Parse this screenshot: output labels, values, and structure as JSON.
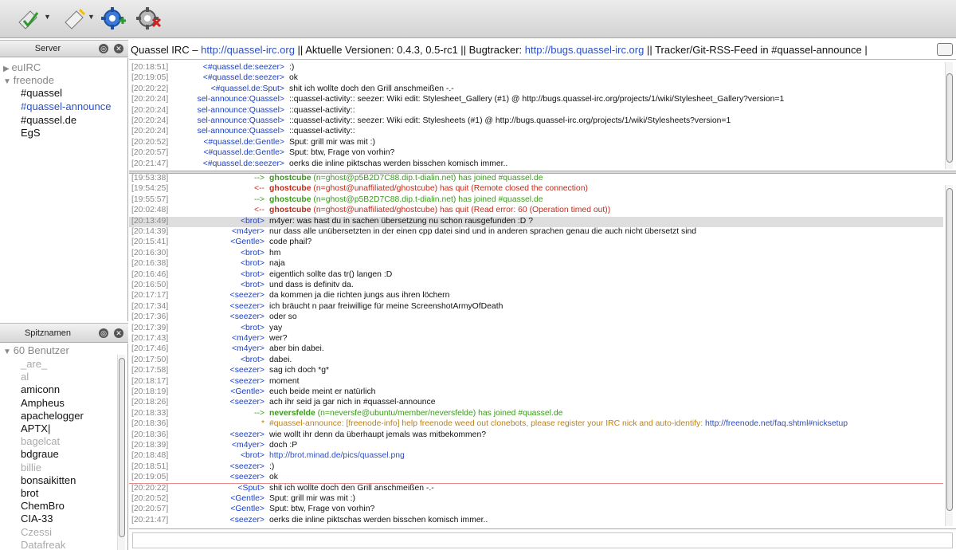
{
  "toolbar": {
    "buttons": [
      {
        "name": "connect-icon"
      },
      {
        "name": "disconnect-icon"
      },
      {
        "name": "add-network-icon"
      },
      {
        "name": "remove-network-icon"
      }
    ]
  },
  "server_panel": {
    "title": "Server",
    "networks": [
      {
        "label": "euIRC",
        "expanded": false
      },
      {
        "label": "freenode",
        "expanded": true,
        "channels": [
          "#quassel",
          "#quassel-announce",
          "#quassel.de",
          "EgS"
        ]
      }
    ]
  },
  "nick_panel": {
    "title": "Spitznamen",
    "count_label": "60 Benutzer",
    "nicks": [
      {
        "n": "_are_",
        "away": true
      },
      {
        "n": "al",
        "away": true
      },
      {
        "n": "amiconn",
        "away": false
      },
      {
        "n": "Ampheus",
        "away": false
      },
      {
        "n": "apachelogger",
        "away": false
      },
      {
        "n": "APTX|",
        "away": false
      },
      {
        "n": "bagelcat",
        "away": true
      },
      {
        "n": "bdgraue",
        "away": false
      },
      {
        "n": "billie",
        "away": true
      },
      {
        "n": "bonsaikitten",
        "away": false
      },
      {
        "n": "brot",
        "away": false
      },
      {
        "n": "ChemBro",
        "away": false
      },
      {
        "n": "CIA-33",
        "away": false
      },
      {
        "n": "Czessi",
        "away": true
      },
      {
        "n": "Datafreak",
        "away": true
      }
    ]
  },
  "topic": {
    "parts": [
      {
        "t": "Quassel IRC – ",
        "link": false
      },
      {
        "t": "http://quassel-irc.org",
        "link": true
      },
      {
        "t": " || Aktuelle Versionen: 0.4.3, 0.5-rc1 || Bugtracker: ",
        "link": false
      },
      {
        "t": "http://bugs.quassel-irc.org",
        "link": true
      },
      {
        "t": " || Tracker/Git-RSS-Feed in #quassel-announce |",
        "link": false
      }
    ]
  },
  "top_buffer": {
    "lines": [
      {
        "ts": "[20:18:51]",
        "nick": "<#quassel.de:seezer>",
        "msg": ":)"
      },
      {
        "ts": "[20:19:05]",
        "nick": "<#quassel.de:seezer>",
        "msg": "ok"
      },
      {
        "ts": "[20:20:22]",
        "nick": "<#quassel.de:Sput>",
        "msg": "shit ich wollte doch den Grill anschmeißen -.-"
      },
      {
        "ts": "[20:20:24]",
        "nick": "sel-announce:Quassel>",
        "msg": "::quassel-activity:: seezer: Wiki edit: Stylesheet_Gallery (#1) @ http://bugs.quassel-irc.org/projects/1/wiki/Stylesheet_Gallery?version=1"
      },
      {
        "ts": "[20:20:24]",
        "nick": "sel-announce:Quassel>",
        "msg": "::quassel-activity::"
      },
      {
        "ts": "[20:20:24]",
        "nick": "sel-announce:Quassel>",
        "msg": "::quassel-activity:: seezer: Wiki edit: Stylesheets (#1) @ http://bugs.quassel-irc.org/projects/1/wiki/Stylesheets?version=1"
      },
      {
        "ts": "[20:20:24]",
        "nick": "sel-announce:Quassel>",
        "msg": "::quassel-activity::"
      },
      {
        "ts": "[20:20:52]",
        "nick": "<#quassel.de:Gentle>",
        "msg": "Sput: grill mir was mit :)"
      },
      {
        "ts": "[20:20:57]",
        "nick": "<#quassel.de:Gentle>",
        "msg": "Sput: btw, Frage von vorhin?"
      },
      {
        "ts": "[20:21:47]",
        "nick": "<#quassel.de:seezer>",
        "msg": "oerks die inline piktschas werden bisschen komisch immer.."
      }
    ]
  },
  "bottom_buffer": {
    "lines": [
      {
        "ts": "[19:53:38]",
        "nick": "-->",
        "kind": "join",
        "who": "ghostcube",
        "msg": " (n=ghost@p5B2D7C88.dip.t-dialin.net) has joined #quassel.de"
      },
      {
        "ts": "[19:54:25]",
        "nick": "<--",
        "kind": "quit",
        "who": "ghostcube",
        "msg": " (n=ghost@unaffiliated/ghostcube) has quit (Remote closed the connection)"
      },
      {
        "ts": "[19:55:57]",
        "nick": "-->",
        "kind": "join",
        "who": "ghostcube",
        "msg": " (n=ghost@p5B2D7C88.dip.t-dialin.net) has joined #quassel.de"
      },
      {
        "ts": "[20:02:48]",
        "nick": "<--",
        "kind": "quit",
        "who": "ghostcube",
        "msg": " (n=ghost@unaffiliated/ghostcube) has quit (Read error: 60 (Operation timed out))"
      },
      {
        "ts": "[20:13:49]",
        "nick": "<brot>",
        "kind": "hl",
        "msg": "m4yer: was hast du in sachen übersetzung nu schon rausgefunden :D ?"
      },
      {
        "ts": "[20:14:39]",
        "nick": "<m4yer>",
        "msg": "nur dass alle unübersetzten in der einen cpp datei sind und in anderen sprachen genau die auch nicht übersetzt sind"
      },
      {
        "ts": "[20:15:41]",
        "nick": "<Gentle>",
        "msg": "code phail?"
      },
      {
        "ts": "[20:16:30]",
        "nick": "<brot>",
        "msg": "hm"
      },
      {
        "ts": "[20:16:38]",
        "nick": "<brot>",
        "msg": "naja"
      },
      {
        "ts": "[20:16:46]",
        "nick": "<brot>",
        "msg": "eigentlich sollte das tr() langen :D"
      },
      {
        "ts": "[20:16:50]",
        "nick": "<brot>",
        "msg": "und dass is definitv da."
      },
      {
        "ts": "[20:17:17]",
        "nick": "<seezer>",
        "msg": "da kommen ja die richten jungs aus ihren löchern"
      },
      {
        "ts": "[20:17:34]",
        "nick": "<seezer>",
        "msg": "ich bräucht n paar freiwillige für meine ScreenshotArmyOfDeath"
      },
      {
        "ts": "[20:17:36]",
        "nick": "<seezer>",
        "msg": "oder so"
      },
      {
        "ts": "[20:17:39]",
        "nick": "<brot>",
        "msg": "yay"
      },
      {
        "ts": "[20:17:43]",
        "nick": "<m4yer>",
        "msg": "wer?"
      },
      {
        "ts": "[20:17:46]",
        "nick": "<m4yer>",
        "msg": "aber bin dabei."
      },
      {
        "ts": "[20:17:50]",
        "nick": "<brot>",
        "msg": "dabei."
      },
      {
        "ts": "[20:17:58]",
        "nick": "<seezer>",
        "msg": "sag ich doch *g*"
      },
      {
        "ts": "[20:18:17]",
        "nick": "<seezer>",
        "msg": "moment"
      },
      {
        "ts": "[20:18:19]",
        "nick": "<Gentle>",
        "msg": "euch beide meint er natürlich"
      },
      {
        "ts": "[20:18:26]",
        "nick": "<seezer>",
        "msg": "ach ihr seid ja gar nich in #quassel-announce"
      },
      {
        "ts": "[20:18:33]",
        "nick": "-->",
        "kind": "join",
        "who": "neversfelde",
        "msg": " (n=neversfe@ubuntu/member/neversfelde) has joined #quassel.de"
      },
      {
        "ts": "[20:18:36]",
        "nick": "*",
        "kind": "notice",
        "msg": "#quassel-announce: [freenode-info] help freenode weed out clonebots, please register your IRC nick and auto-identify: ",
        "link": "http://freenode.net/faq.shtml#nicksetup"
      },
      {
        "ts": "[20:18:36]",
        "nick": "<seezer>",
        "msg": "wie wollt ihr denn da überhaupt jemals was mitbekommen?"
      },
      {
        "ts": "[20:18:39]",
        "nick": "<m4yer>",
        "msg": "doch :P"
      },
      {
        "ts": "[20:18:48]",
        "nick": "<brot>",
        "kind": "url",
        "msg": "http://brot.minad.de/pics/quassel.png"
      },
      {
        "ts": "[20:18:51]",
        "nick": "<seezer>",
        "msg": ":)"
      },
      {
        "ts": "[20:19:05]",
        "nick": "<seezer>",
        "msg": "ok"
      },
      {
        "ts": "[20:20:22]",
        "nick": "<Sput>",
        "msg": "shit ich wollte doch den Grill anschmeißen -.-"
      },
      {
        "ts": "[20:20:52]",
        "nick": "<Gentle>",
        "msg": "Sput: grill mir was mit :)"
      },
      {
        "ts": "[20:20:57]",
        "nick": "<Gentle>",
        "msg": "Sput: btw, Frage von vorhin?"
      },
      {
        "ts": "[20:21:47]",
        "nick": "<seezer>",
        "msg": "oerks die inline piktschas werden bisschen komisch immer.."
      }
    ]
  },
  "colors": {
    "nick": "#1a3fc6",
    "join": "#3a9a1a",
    "quit": "#c42a1a",
    "notice": "#c08010",
    "link": "#2b4fc8",
    "marker": "#e88a8a"
  }
}
